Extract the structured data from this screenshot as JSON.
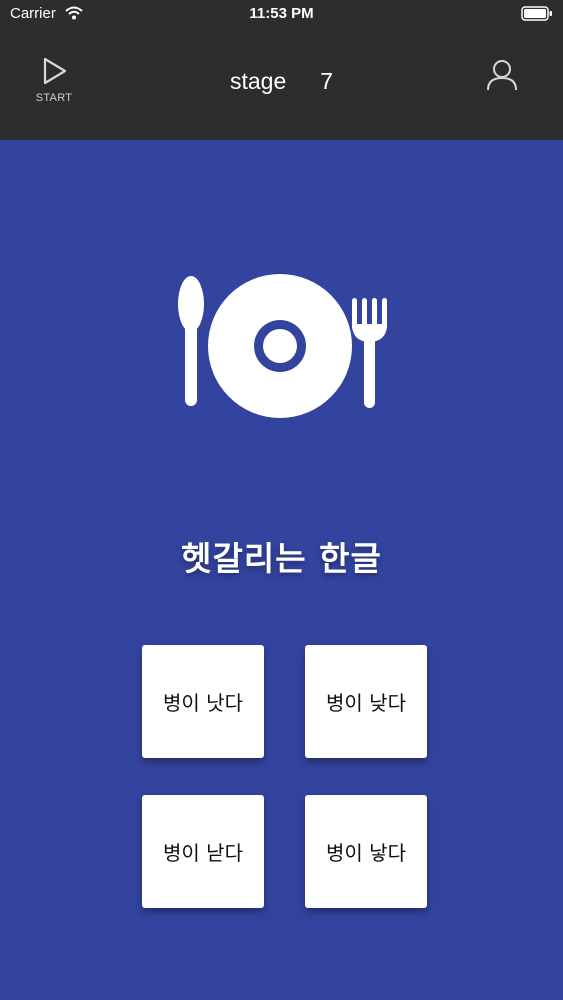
{
  "status_bar": {
    "carrier": "Carrier",
    "time": "11:53 PM",
    "icons": [
      "wifi-icon",
      "battery-icon"
    ]
  },
  "nav": {
    "start_label": "START",
    "stage_label": "stage",
    "stage_number": "7",
    "icons": [
      "play-icon",
      "user-icon"
    ]
  },
  "main": {
    "illustration_icon": "dish-cutlery-icon",
    "title": "헷갈리는 한글",
    "choices": [
      {
        "label": "병이 낫다"
      },
      {
        "label": "병이 낮다"
      },
      {
        "label": "병이 낟다"
      },
      {
        "label": "병이 낳다"
      }
    ]
  },
  "colors": {
    "background": "#33449f",
    "bar": "#2d2d2d",
    "card": "#ffffff"
  }
}
